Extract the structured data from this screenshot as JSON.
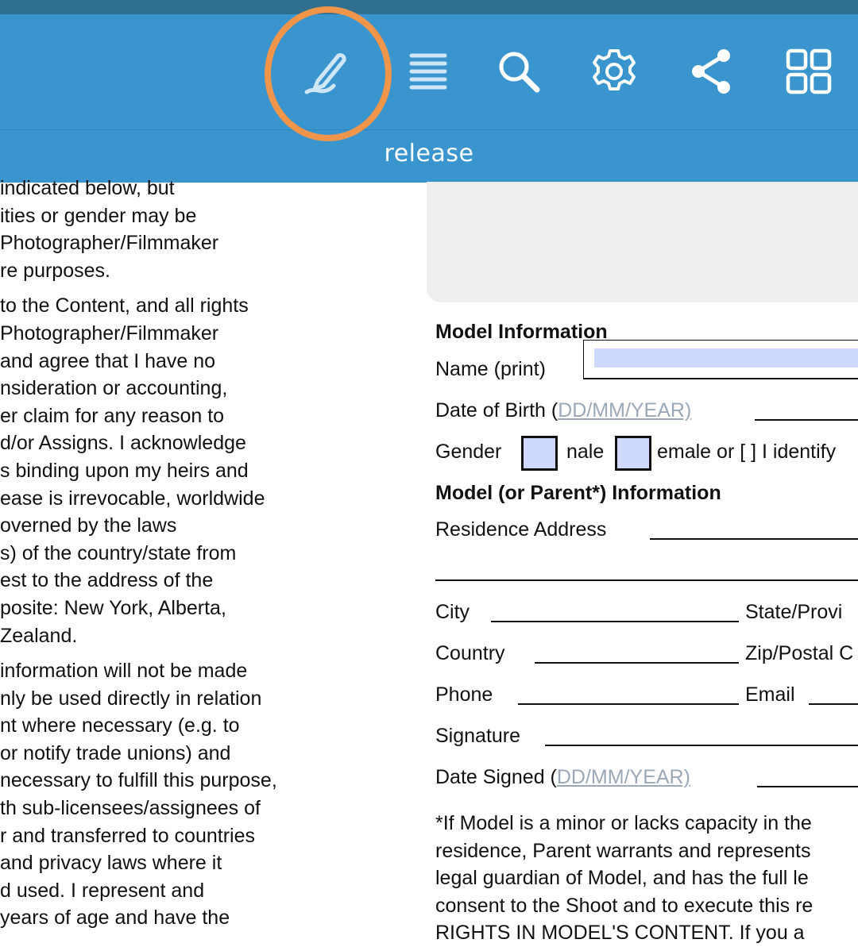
{
  "toolbar": {
    "icons": [
      "annotate-pen-icon",
      "list-icon",
      "search-icon",
      "settings-gear-icon",
      "share-icon",
      "grid-view-icon"
    ],
    "document_title": "release",
    "colors": {
      "bar": "#3a95cf",
      "status": "#2f6f8f",
      "ring": "#f0954a",
      "field": "#cfd8ff"
    }
  },
  "left_text": {
    "para1": [
      "indicated below, but",
      "ities or gender may be",
      "Photographer/Filmmaker",
      "re purposes."
    ],
    "para2": [
      "to the Content, and all rights",
      " Photographer/Filmmaker",
      " and agree that I have no",
      "nsideration or accounting,",
      "er claim for any reason to",
      "d/or Assigns. I acknowledge",
      "s binding upon my heirs and",
      "ease is irrevocable, worldwide",
      "overned by the laws",
      "s) of the country/state from",
      "est to the address of the",
      "posite: New York, Alberta,",
      " Zealand."
    ],
    "para3": [
      " information will not be made",
      "nly be used directly in relation",
      "nt where necessary (e.g. to",
      " or notify trade unions) and",
      "necessary to fulfill this purpose,",
      "th sub-licensees/assignees of",
      "r and transferred to countries",
      " and privacy laws where it",
      "d used. I represent and",
      " years of age and have the"
    ]
  },
  "form": {
    "model_info_heading": "Model Information",
    "name_label": "Name (print)",
    "dob_label": "Date of Birth (",
    "dob_hint": "DD/MM/YEAR)",
    "gender_label": "Gender",
    "gender_male": "nale",
    "gender_female_rest": "emale or [  ] I identify",
    "parent_heading": "Model (or Parent*) Information",
    "residence_label": "Residence Address",
    "city_label": "City",
    "state_label": "State/Provi",
    "country_label": "Country",
    "zip_label": "Zip/Postal C",
    "phone_label": "Phone",
    "email_label": "Email",
    "signature_label": "Signature",
    "date_signed_label": "Date Signed (",
    "date_signed_hint": "DD/MM/YEAR)"
  },
  "footnote": [
    "*If Model is a minor or lacks capacity in the",
    "residence, Parent warrants and represents",
    "legal guardian of Model, and has the full le",
    "consent to the Shoot and to execute this re",
    "RIGHTS IN MODEL'S CONTENT. If you a"
  ]
}
